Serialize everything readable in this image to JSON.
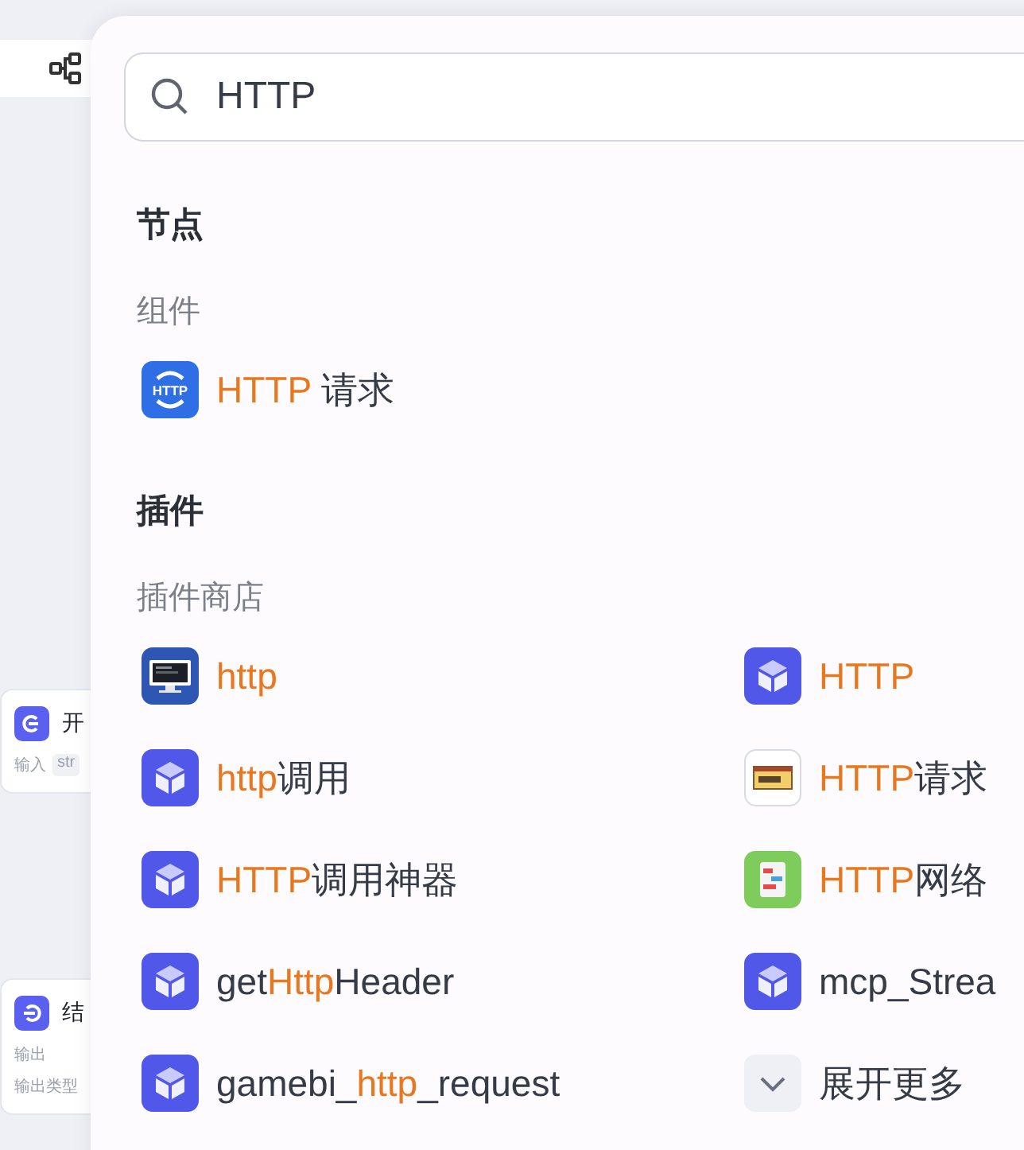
{
  "canvas": {
    "nodes": [
      {
        "kind": "start",
        "title": "开",
        "rows": [
          {
            "label": "输入",
            "value": "str"
          }
        ]
      },
      {
        "kind": "end",
        "title": "结",
        "rows": [
          {
            "label": "输出"
          },
          {
            "label": "输出类型"
          }
        ]
      }
    ]
  },
  "search": {
    "value": "HTTP"
  },
  "sections": [
    {
      "title": "节点",
      "groups": [
        {
          "title": "组件",
          "items": [
            {
              "kind": "http-globe",
              "badge": "HTTP",
              "parts": [
                {
                  "text": "HTTP",
                  "match": true
                },
                {
                  "text": " 请求",
                  "match": false
                }
              ]
            }
          ]
        }
      ]
    },
    {
      "title": "插件",
      "groups": [
        {
          "title": "插件商店",
          "items": [
            {
              "kind": "monitor",
              "parts": [
                {
                  "text": "http",
                  "match": true
                }
              ]
            },
            {
              "kind": "cube",
              "parts": [
                {
                  "text": "HTTP",
                  "match": true
                }
              ]
            },
            {
              "kind": "cube",
              "parts": [
                {
                  "text": "http",
                  "match": true
                },
                {
                  "text": "调用",
                  "match": false
                }
              ]
            },
            {
              "kind": "browser",
              "parts": [
                {
                  "text": "HTTP",
                  "match": true
                },
                {
                  "text": "请求",
                  "match": false
                }
              ]
            },
            {
              "kind": "cube",
              "parts": [
                {
                  "text": "HTTP",
                  "match": true
                },
                {
                  "text": "调用神器",
                  "match": false
                }
              ]
            },
            {
              "kind": "sticker",
              "parts": [
                {
                  "text": "HTTP",
                  "match": true
                },
                {
                  "text": "网络",
                  "match": false
                }
              ]
            },
            {
              "kind": "cube",
              "parts": [
                {
                  "text": "get",
                  "match": false
                },
                {
                  "text": "Http",
                  "match": true
                },
                {
                  "text": "Header",
                  "match": false
                }
              ]
            },
            {
              "kind": "cube",
              "parts": [
                {
                  "text": "mcp_Strea",
                  "match": false
                }
              ]
            },
            {
              "kind": "cube",
              "parts": [
                {
                  "text": "gamebi_",
                  "match": false
                },
                {
                  "text": "http",
                  "match": true
                },
                {
                  "text": "_request",
                  "match": false
                }
              ]
            },
            {
              "kind": "more",
              "parts": [
                {
                  "text": "展开更多",
                  "match": false
                }
              ]
            }
          ]
        }
      ]
    }
  ]
}
